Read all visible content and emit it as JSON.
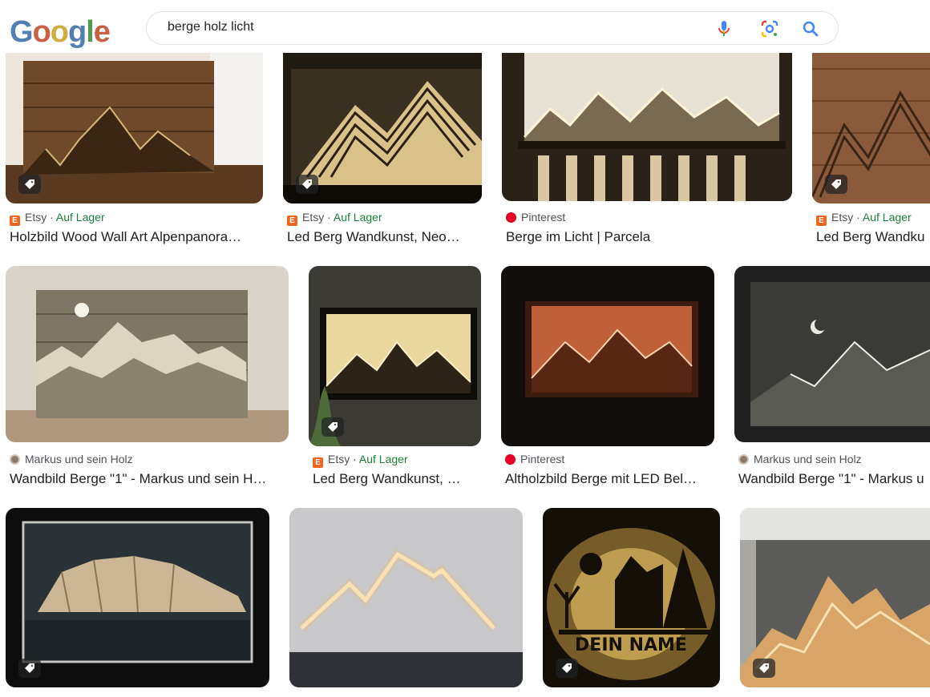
{
  "logo": {
    "letters": [
      "G",
      "o",
      "o",
      "g",
      "l",
      "e"
    ],
    "colors": [
      "#3b6ea8",
      "#c44a2a",
      "#c9a227",
      "#3b6ea8",
      "#3e8a3a",
      "#c44a2a"
    ]
  },
  "search": {
    "query": "berge holz licht",
    "icons": [
      "microphone-icon",
      "lens-icon",
      "search-icon"
    ]
  },
  "results": [
    {
      "source": "Etsy",
      "stock": "Auf Lager",
      "title": "Holzbild Wood Wall Art Alpenpanora…",
      "favicon": "etsy",
      "tag": true
    },
    {
      "source": "Etsy",
      "stock": "Auf Lager",
      "title": "Led Berg Wandkunst, Neo…",
      "favicon": "etsy",
      "tag": true
    },
    {
      "source": "Pinterest",
      "stock": "",
      "title": "Berge im Licht | Parcela",
      "favicon": "pinterest",
      "tag": false
    },
    {
      "source": "Etsy",
      "stock": "Auf Lager",
      "title": "Led Berg Wandku",
      "favicon": "etsy",
      "tag": true
    },
    {
      "source": "Markus und sein Holz",
      "stock": "",
      "title": "Wandbild Berge \"1\" - Markus und sein H…",
      "favicon": "markus",
      "tag": false
    },
    {
      "source": "Etsy",
      "stock": "Auf Lager",
      "title": "Led Berg Wandkunst, …",
      "favicon": "etsy",
      "tag": true
    },
    {
      "source": "Pinterest",
      "stock": "",
      "title": "Altholzbild Berge mit LED Bel…",
      "favicon": "pinterest",
      "tag": false
    },
    {
      "source": "Markus und sein Holz",
      "stock": "",
      "title": "Wandbild Berge \"1\" - Markus u",
      "favicon": "markus",
      "tag": false
    },
    {
      "source": "",
      "stock": "",
      "title": "",
      "favicon": "",
      "tag": true
    },
    {
      "source": "",
      "stock": "",
      "title": "",
      "favicon": "",
      "tag": false
    },
    {
      "source": "",
      "stock": "",
      "title": "",
      "favicon": "",
      "tag": true
    },
    {
      "source": "",
      "stock": "",
      "title": "",
      "favicon": "",
      "tag": true
    }
  ],
  "artwork_text": {
    "name_sign": "DEIN NAME"
  }
}
